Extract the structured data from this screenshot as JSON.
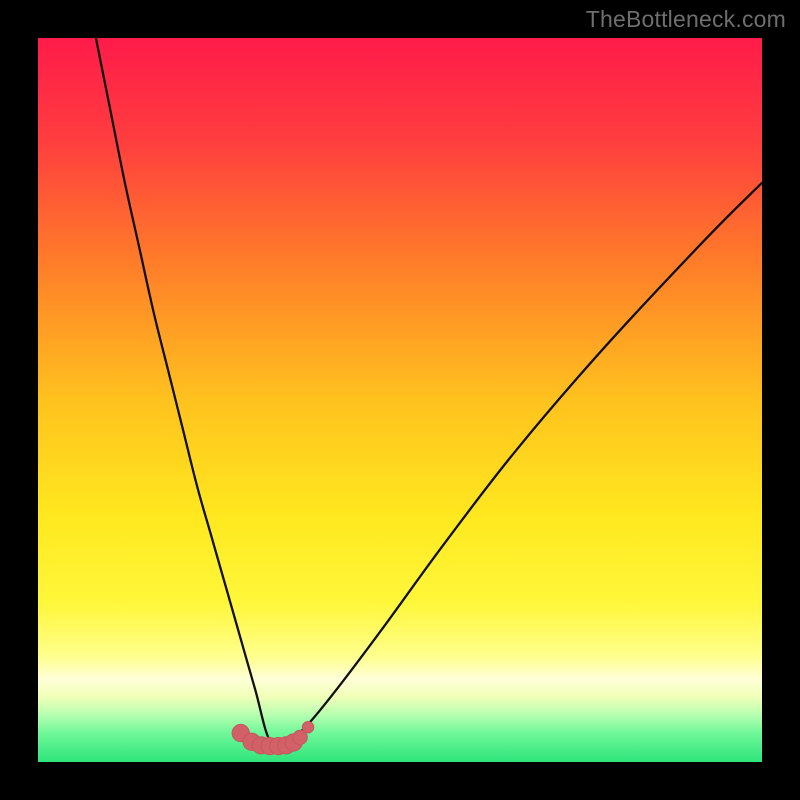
{
  "watermark": "TheBottleneck.com",
  "colors": {
    "frame_bg": "#000000",
    "grad_top": "#ff1b4a",
    "grad_upper_mid": "#ff6030",
    "grad_mid": "#ffc419",
    "grad_lower_mid": "#fff825",
    "grad_pale_band": "#ffffc0",
    "grad_mint": "#7cf7a5",
    "grad_green": "#2de57a",
    "curve_stroke": "#111111",
    "marker_fill": "#d16166",
    "marker_stroke": "#c2565c"
  },
  "chart_data": {
    "type": "line",
    "title": "",
    "xlabel": "",
    "ylabel": "",
    "xlim": [
      0,
      100
    ],
    "ylim": [
      0,
      100
    ],
    "notes": "Axes are unlabeled; background is a vertical rainbow gradient from red (top, high bottleneck %) to green (bottom, low bottleneck %). A V-shaped black curve descends from upper-left to a minimum near x≈32 and rises toward the right. A cluster of salmon/pink markers sits at the trough.",
    "series": [
      {
        "name": "bottleneck-curve",
        "x": [
          8,
          10,
          12,
          14,
          16,
          18,
          20,
          22,
          24,
          26,
          28,
          30,
          32,
          34,
          36,
          38,
          42,
          48,
          56,
          66,
          78,
          92,
          100
        ],
        "y": [
          100,
          90,
          80,
          71,
          62,
          54,
          46,
          38,
          31,
          24,
          17,
          10,
          3,
          3,
          4,
          6,
          11,
          19,
          30,
          43,
          57,
          72,
          80
        ]
      }
    ],
    "markers": [
      {
        "x": 28.0,
        "y": 4.0,
        "r": 1.2
      },
      {
        "x": 29.5,
        "y": 2.8,
        "r": 1.2
      },
      {
        "x": 30.8,
        "y": 2.3,
        "r": 1.2
      },
      {
        "x": 32.0,
        "y": 2.2,
        "r": 1.2
      },
      {
        "x": 33.2,
        "y": 2.2,
        "r": 1.2
      },
      {
        "x": 34.3,
        "y": 2.3,
        "r": 1.2
      },
      {
        "x": 35.3,
        "y": 2.7,
        "r": 1.2
      },
      {
        "x": 36.2,
        "y": 3.4,
        "r": 1.0
      },
      {
        "x": 37.3,
        "y": 4.8,
        "r": 0.8
      }
    ]
  }
}
